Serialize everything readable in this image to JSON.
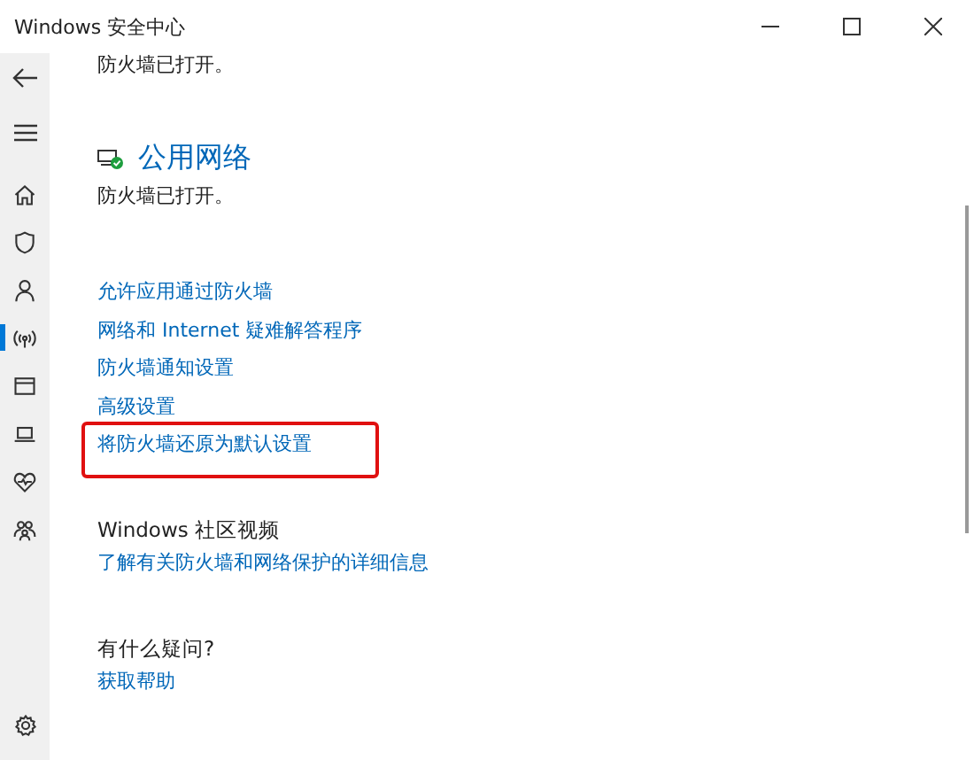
{
  "window": {
    "title": "Windows 安全中心"
  },
  "sidebar": {
    "items": [
      {
        "kind": "home",
        "selected": false
      },
      {
        "kind": "shield",
        "selected": false
      },
      {
        "kind": "person",
        "selected": false
      },
      {
        "kind": "wifi",
        "selected": true
      },
      {
        "kind": "window",
        "selected": false
      },
      {
        "kind": "laptop",
        "selected": false
      },
      {
        "kind": "heart",
        "selected": false
      },
      {
        "kind": "family",
        "selected": false
      }
    ]
  },
  "top_status": "防火墙已打开。",
  "network": {
    "title": "公用网络",
    "status": "防火墙已打开。"
  },
  "links": [
    {
      "label": "允许应用通过防火墙",
      "highlighted": false
    },
    {
      "label": "网络和 Internet 疑难解答程序",
      "highlighted": false
    },
    {
      "label": "防火墙通知设置",
      "highlighted": false
    },
    {
      "label": "高级设置",
      "highlighted": false
    },
    {
      "label": "将防火墙还原为默认设置",
      "highlighted": true
    }
  ],
  "sections": [
    {
      "heading": "Windows 社区视频",
      "link": "了解有关防火墙和网络保护的详细信息"
    },
    {
      "heading": "有什么疑问?",
      "link": "获取帮助"
    }
  ]
}
